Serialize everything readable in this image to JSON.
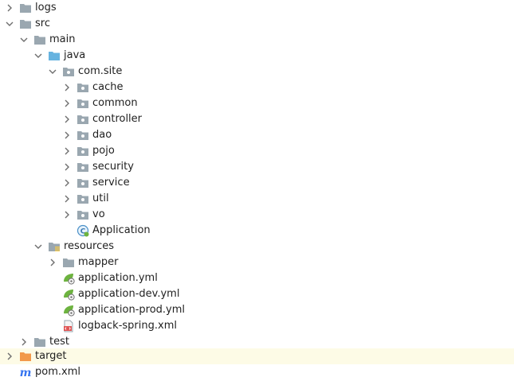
{
  "project_tree": {
    "items": [
      {
        "label": "logs",
        "kind": "folder",
        "toggle": "collapsed"
      },
      {
        "label": "src",
        "kind": "folder",
        "toggle": "expanded"
      },
      {
        "label": "main",
        "kind": "folder",
        "toggle": "expanded"
      },
      {
        "label": "java",
        "kind": "source-root",
        "toggle": "expanded"
      },
      {
        "label": "com.site",
        "kind": "package",
        "toggle": "expanded"
      },
      {
        "label": "cache",
        "kind": "package",
        "toggle": "collapsed"
      },
      {
        "label": "common",
        "kind": "package",
        "toggle": "collapsed"
      },
      {
        "label": "controller",
        "kind": "package",
        "toggle": "collapsed"
      },
      {
        "label": "dao",
        "kind": "package",
        "toggle": "collapsed"
      },
      {
        "label": "pojo",
        "kind": "package",
        "toggle": "collapsed"
      },
      {
        "label": "security",
        "kind": "package",
        "toggle": "collapsed"
      },
      {
        "label": "service",
        "kind": "package",
        "toggle": "collapsed"
      },
      {
        "label": "util",
        "kind": "package",
        "toggle": "collapsed"
      },
      {
        "label": "vo",
        "kind": "package",
        "toggle": "collapsed"
      },
      {
        "label": "Application",
        "kind": "spring-class",
        "toggle": "none"
      },
      {
        "label": "resources",
        "kind": "resources-root",
        "toggle": "expanded"
      },
      {
        "label": "mapper",
        "kind": "folder",
        "toggle": "collapsed"
      },
      {
        "label": "application.yml",
        "kind": "spring-config",
        "toggle": "none"
      },
      {
        "label": "application-dev.yml",
        "kind": "spring-config",
        "toggle": "none"
      },
      {
        "label": "application-prod.yml",
        "kind": "spring-config",
        "toggle": "none"
      },
      {
        "label": "logback-spring.xml",
        "kind": "xml-file",
        "toggle": "none"
      },
      {
        "label": "test",
        "kind": "folder",
        "toggle": "collapsed"
      },
      {
        "label": "target",
        "kind": "excluded-folder",
        "toggle": "collapsed",
        "selected": true
      },
      {
        "label": "pom.xml",
        "kind": "maven-file",
        "toggle": "none"
      }
    ]
  },
  "colors": {
    "folder": "#9aa7b0",
    "source_root": "#66b3e0",
    "excluded_folder": "#f2994a",
    "spring_green": "#6db33f",
    "maven_blue": "#3574f0",
    "xml_red": "#e05555",
    "chevron": "#6e6e6e",
    "selected_row_bg": "#fdfbe6"
  },
  "icons": {
    "collapsed": "chevron-right-icon",
    "expanded": "chevron-down-icon",
    "folder": "folder-icon",
    "source-root": "source-root-folder-icon",
    "resources-root": "resources-root-folder-icon",
    "excluded-folder": "excluded-folder-icon",
    "package": "package-icon",
    "spring-class": "spring-boot-class-icon",
    "spring-config": "spring-config-file-icon",
    "xml-file": "xml-file-icon",
    "maven-file": "maven-file-icon"
  }
}
